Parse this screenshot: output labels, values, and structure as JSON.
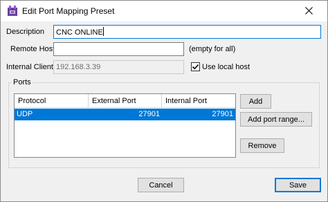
{
  "window": {
    "title": "Edit Port Mapping Preset"
  },
  "form": {
    "description_label": "Description",
    "description_value": "CNC ONLINE",
    "remote_host_label": "Remote Host",
    "remote_host_value": "",
    "remote_host_hint": "(empty for all)",
    "internal_client_label": "Internal Client",
    "internal_client_value": "192.168.3.39",
    "use_local_host_label": "Use local host",
    "use_local_host_checked": true
  },
  "ports": {
    "group_label": "Ports",
    "columns": [
      "Protocol",
      "External Port",
      "Internal Port"
    ],
    "rows": [
      {
        "protocol": "UDP",
        "external_port": "27901",
        "internal_port": "27901",
        "selected": true
      }
    ],
    "add_label": "Add",
    "add_range_label": "Add port range...",
    "remove_label": "Remove"
  },
  "footer": {
    "cancel_label": "Cancel",
    "save_label": "Save"
  },
  "colors": {
    "selection": "#0078d7",
    "focus_border": "#0078d7"
  }
}
